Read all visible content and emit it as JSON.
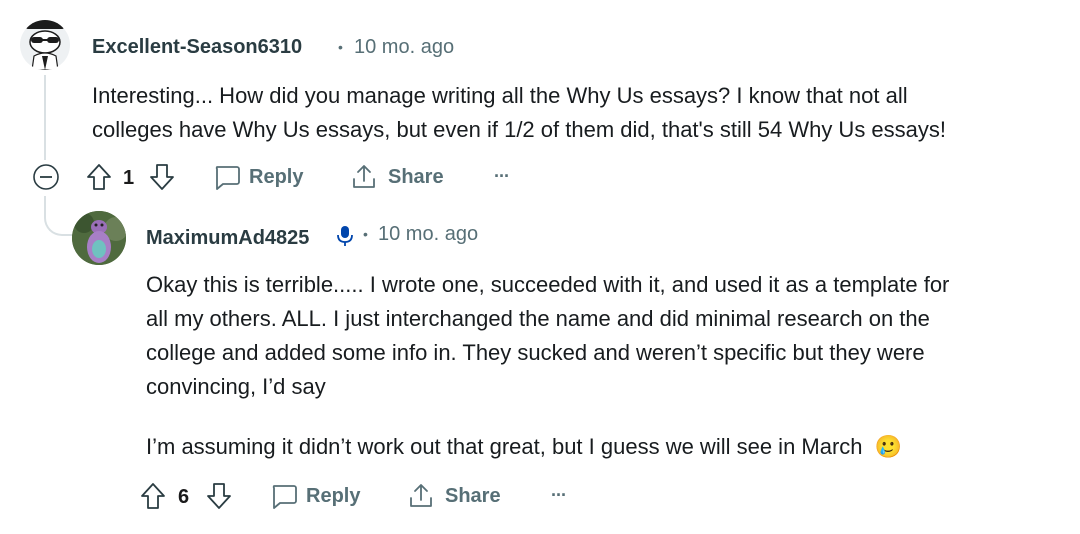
{
  "comments": [
    {
      "username": "Excellent-Season6310",
      "separator": "•",
      "time": "10 mo. ago",
      "body": [
        "Interesting... How did you manage writing all the Why Us essays? I know that not all",
        "colleges have Why Us essays, but even if 1/2 of them did, that's still 54 Why Us essays!"
      ],
      "actions": {
        "votes": "1",
        "reply": "Reply",
        "share": "Share",
        "more": "···"
      }
    },
    {
      "username": "MaximumAd4825",
      "separator": "•",
      "time": "10 mo. ago",
      "body": [
        "Okay this is terrible..... I wrote one, succeeded with it, and used it as a template for",
        "all my others. ALL. I just interchanged the name and did minimal research on the",
        "college and added some info in. They sucked and weren’t specific but they were",
        "convincing, I’d say"
      ],
      "body2": "I’m assuming it didn’t work out that great, but I guess we will see in March",
      "emoji": "🥲",
      "actions": {
        "votes": "6",
        "reply": "Reply",
        "share": "Share",
        "more": "···"
      }
    }
  ]
}
